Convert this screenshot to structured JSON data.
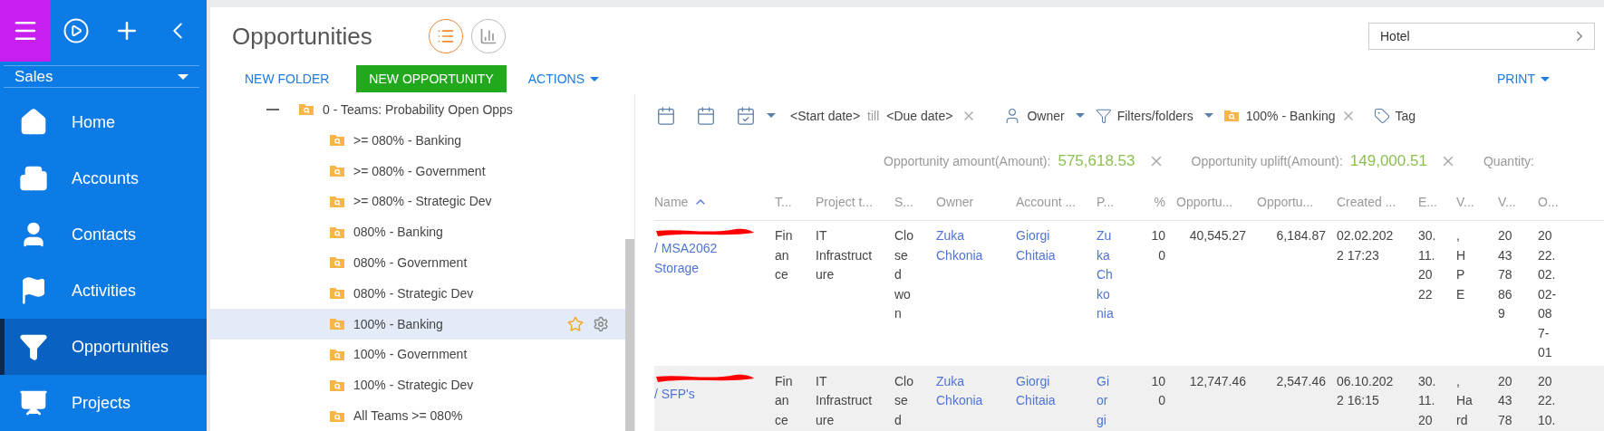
{
  "sidebar": {
    "module": "Sales",
    "items": [
      {
        "label": "Home",
        "selected": false
      },
      {
        "label": "Accounts",
        "selected": false
      },
      {
        "label": "Contacts",
        "selected": false
      },
      {
        "label": "Activities",
        "selected": false
      },
      {
        "label": "Opportunities",
        "selected": true
      },
      {
        "label": "Projects",
        "selected": false
      }
    ]
  },
  "header": {
    "title": "Opportunities",
    "views": [
      {
        "selected": true
      },
      {
        "selected": false
      }
    ],
    "search": {
      "value": "Hotel"
    }
  },
  "toolbar": {
    "buttons": [
      {
        "label": "NEW FOLDER",
        "kind": "link"
      },
      {
        "label": "NEW OPPORTUNITY",
        "kind": "primary"
      },
      {
        "label": "ACTIONS",
        "kind": "menu"
      }
    ],
    "print": "PRINT"
  },
  "folders": {
    "label": "0 - Teams: Probability Open Opps",
    "expanded": true,
    "children": [
      {
        "label": ">= 080% - Banking",
        "selected": false
      },
      {
        "label": ">= 080% - Government",
        "selected": false
      },
      {
        "label": ">= 080% - Strategic Dev",
        "selected": false
      },
      {
        "label": "080% - Banking",
        "selected": false
      },
      {
        "label": "080% - Government",
        "selected": false
      },
      {
        "label": "080% - Strategic Dev",
        "selected": false
      },
      {
        "label": "100% - Banking",
        "selected": true
      },
      {
        "label": "100% - Government",
        "selected": false
      },
      {
        "label": "100% - Strategic Dev",
        "selected": false
      },
      {
        "label": "All Teams >= 080%",
        "selected": false
      }
    ]
  },
  "filters": {
    "start": "<Start date>",
    "till": "till",
    "due": "<Due date>",
    "owner": "Owner",
    "folders": "Filters/folders",
    "chip": "100% - Banking",
    "tag": "Tag"
  },
  "summary": [
    {
      "label": "Opportunity amount(Amount):",
      "value": "575,618.53"
    },
    {
      "label": "Opportunity uplift(Amount):",
      "value": "149,000.51"
    },
    {
      "label": "Quantity:"
    }
  ],
  "table": {
    "columns": [
      {
        "label": "Name",
        "sorted": true,
        "link": true
      },
      {
        "label": "T...",
        "sorted": false,
        "link": false
      },
      {
        "label": "Project t...",
        "sorted": false,
        "link": false
      },
      {
        "label": "S...",
        "sorted": false,
        "link": false
      },
      {
        "label": "Owner",
        "sorted": false,
        "link": true
      },
      {
        "label": "Account ...",
        "sorted": false,
        "link": true
      },
      {
        "label": "P...",
        "sorted": false,
        "link": true
      },
      {
        "label": "%",
        "sorted": false,
        "link": false
      },
      {
        "label": "Opportu...",
        "sorted": false,
        "link": false
      },
      {
        "label": "Opportu...",
        "sorted": false,
        "link": false
      },
      {
        "label": "Created ...",
        "sorted": false,
        "link": false
      },
      {
        "label": "E...",
        "sorted": false,
        "link": false
      },
      {
        "label": "V...",
        "sorted": false,
        "link": false
      },
      {
        "label": "V...",
        "sorted": false,
        "link": false
      },
      {
        "label": "O...",
        "sorted": false,
        "link": false
      }
    ],
    "rows": [
      {
        "highlighted": false,
        "redacted": true,
        "cells": [
          "/ MSA2062 Storage",
          "Finance",
          "IT Infrastructure",
          "Closed won",
          "Zuka Chkonia",
          "Giorgi Chitaia",
          "Zuka Chkonia",
          "100",
          "40,545.27",
          "6,184.87",
          "02.02.2022 17:23",
          "30.11.2022",
          ", HPE",
          "204378869",
          "2022.02.02-087-01"
        ]
      },
      {
        "highlighted": true,
        "redacted": true,
        "cells": [
          "/ SFP's",
          "Finance",
          "IT Infrastructure",
          "Closed",
          "Zuka Chkonia",
          "Giorgi Chitaia",
          "Giorgi",
          "100",
          "12,747.46",
          "2,547.46",
          "06.10.2022 16:15",
          "30.11.20",
          ", Hard",
          "204378",
          "2022.10."
        ]
      }
    ]
  }
}
